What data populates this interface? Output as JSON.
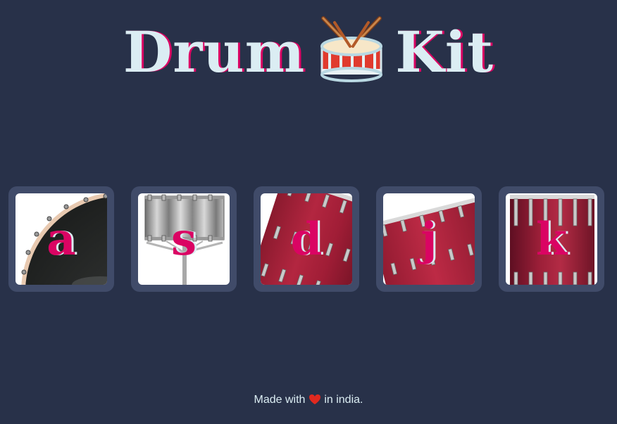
{
  "header": {
    "title_left": "Drum",
    "title_right": "Kit",
    "emoji_icon": "drum-icon"
  },
  "drums": [
    {
      "key": "a",
      "image_icon": "tom-drum-icon"
    },
    {
      "key": "s",
      "image_icon": "snare-drum-icon"
    },
    {
      "key": "d",
      "image_icon": "crash-drum-icon"
    },
    {
      "key": "j",
      "image_icon": "kick-drum-icon"
    },
    {
      "key": "k",
      "image_icon": "bass-drum-icon"
    }
  ],
  "footer": {
    "made_with": "Made with",
    "heart_icon": "heart-icon",
    "suffix": "in india."
  },
  "colors": {
    "background": "#283149",
    "tile": "#404b69",
    "accent": "#da0463",
    "text": "#dbedf3"
  }
}
